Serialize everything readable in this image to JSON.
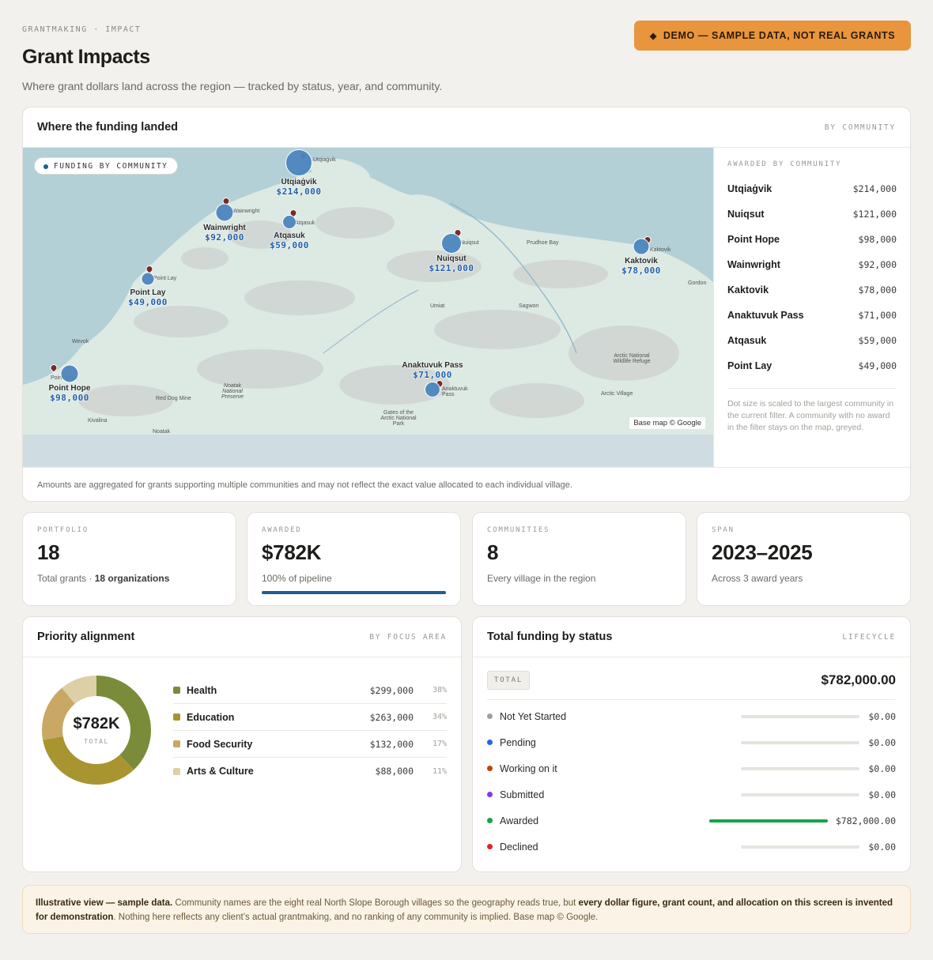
{
  "header": {
    "eyebrow": "GRANTMAKING · IMPACT",
    "title": "Grant Impacts",
    "subtitle": "Where grant dollars land across the region — tracked by status, year, and community.",
    "badge_icon": "diamond-icon",
    "badge": "DEMO — SAMPLE DATA, NOT REAL GRANTS"
  },
  "map_card": {
    "title": "Where the funding landed",
    "tag": "BY COMMUNITY",
    "pill": "FUNDING BY COMMUNITY",
    "credit": "Base map © Google",
    "footnote": "Amounts are aggregated for grants supporting multiple communities and may not reflect the exact value allocated to each individual village.",
    "colors": {
      "water": "#b3d0d6",
      "land": "#dde9e3",
      "bubble": "#4c86bf",
      "pin": "#7a2a26"
    },
    "places": [
      "Utqiaġvik",
      "Wainwright",
      "Atqasuk",
      "Nuiqsut",
      "Prudhoe Bay",
      "Kaktovik",
      "Point Lay",
      "Gordon",
      "Umiat",
      "Sagwon",
      "Wevok",
      "Point Hope",
      "Red Dog Mine",
      "Noatak National Preserve",
      "Kivalina",
      "Noatak",
      "Gates of the Arctic National Park",
      "Arctic National Wildlife Refuge",
      "Arctic Village",
      "Anaktuvuk Pass"
    ],
    "bubbles": [
      {
        "name": "Utqiaġvik",
        "value": "$214,000"
      },
      {
        "name": "Wainwright",
        "value": "$92,000"
      },
      {
        "name": "Atqasuk",
        "value": "$59,000"
      },
      {
        "name": "Nuiqsut",
        "value": "$121,000"
      },
      {
        "name": "Kaktovik",
        "value": "$78,000"
      },
      {
        "name": "Point Lay",
        "value": "$49,000"
      },
      {
        "name": "Point Hope",
        "value": "$98,000"
      },
      {
        "name": "Anaktuvuk Pass",
        "value": "$71,000"
      }
    ],
    "sidebar": {
      "heading": "AWARDED BY COMMUNITY",
      "rows": [
        {
          "name": "Utqiaġvik",
          "value": "$214,000"
        },
        {
          "name": "Nuiqsut",
          "value": "$121,000"
        },
        {
          "name": "Point Hope",
          "value": "$98,000"
        },
        {
          "name": "Wainwright",
          "value": "$92,000"
        },
        {
          "name": "Kaktovik",
          "value": "$78,000"
        },
        {
          "name": "Anaktuvuk Pass",
          "value": "$71,000"
        },
        {
          "name": "Atqasuk",
          "value": "$59,000"
        },
        {
          "name": "Point Lay",
          "value": "$49,000"
        }
      ],
      "note": "Dot size is scaled to the largest community in the current filter. A community with no award in the filter stays on the map, greyed."
    }
  },
  "stats": [
    {
      "label": "PORTFOLIO",
      "value": "18",
      "sub": "Total grants · ",
      "sub_bold": "18 organizations"
    },
    {
      "label": "AWARDED",
      "value": "$782K",
      "sub": "100% of pipeline",
      "progress": 1.0
    },
    {
      "label": "COMMUNITIES",
      "value": "8",
      "sub": "Every village in the region"
    },
    {
      "label": "SPAN",
      "value": "2023–2025",
      "sub": "Across 3 award years"
    }
  ],
  "priority": {
    "title": "Priority alignment",
    "tag": "BY FOCUS AREA",
    "center_value": "$782K",
    "center_label": "TOTAL",
    "items": [
      {
        "name": "Health",
        "amount": "$299,000",
        "pct": "38%",
        "share": 0.38,
        "color": "#7a8c3a"
      },
      {
        "name": "Education",
        "amount": "$263,000",
        "pct": "34%",
        "share": 0.34,
        "color": "#a89530"
      },
      {
        "name": "Food Security",
        "amount": "$132,000",
        "pct": "17%",
        "share": 0.17,
        "color": "#c9a765"
      },
      {
        "name": "Arts & Culture",
        "amount": "$88,000",
        "pct": "11%",
        "share": 0.11,
        "color": "#ddd0a6"
      }
    ]
  },
  "status": {
    "title": "Total funding by status",
    "tag": "LIFECYCLE",
    "total_label": "TOTAL",
    "total_value": "$782,000.00",
    "rows": [
      {
        "name": "Not Yet Started",
        "value": "$0.00",
        "share": 0,
        "color": "#9e9e9e"
      },
      {
        "name": "Pending",
        "value": "$0.00",
        "share": 0,
        "color": "#2563eb"
      },
      {
        "name": "Working on it",
        "value": "$0.00",
        "share": 0,
        "color": "#c2410c"
      },
      {
        "name": "Submitted",
        "value": "$0.00",
        "share": 0,
        "color": "#7c3aed"
      },
      {
        "name": "Awarded",
        "value": "$782,000.00",
        "share": 1.0,
        "color": "#16a34a"
      },
      {
        "name": "Declined",
        "value": "$0.00",
        "share": 0,
        "color": "#dc2626"
      }
    ]
  },
  "disclaimer": {
    "b1": "Illustrative view — sample data.",
    "t1": " Community names are the eight real North Slope Borough villages so the geography reads true, but ",
    "b2": "every dollar figure, grant count, and allocation on this screen is invented for demonstration",
    "t2": ". Nothing here reflects any client’s actual grantmaking, and no ranking of any community is implied. Base map © Google."
  }
}
